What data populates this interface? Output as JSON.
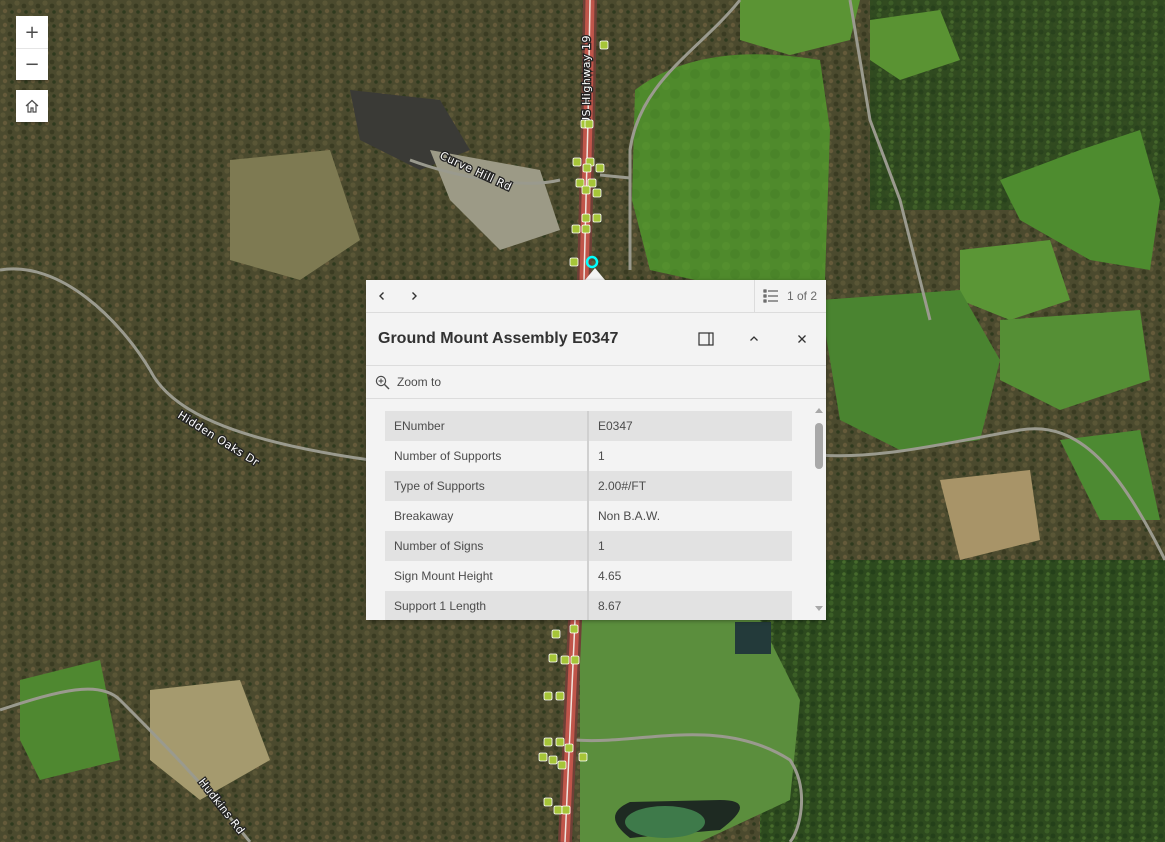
{
  "map": {
    "basemap": "satellite imagery",
    "colors": {
      "highway": "#c0554a",
      "sign_marker": "#a6c538",
      "selected_marker": "#00ffff"
    },
    "road_labels": [
      {
        "id": "us-highway-19",
        "text": "US Highway 19"
      },
      {
        "id": "curve-hill-rd",
        "text": "Curve Hill Rd"
      },
      {
        "id": "hidden-oaks-dr",
        "text": "Hidden Oaks Dr"
      },
      {
        "id": "hudkins-rd",
        "text": "Hudkins Rd"
      }
    ]
  },
  "controls": {
    "zoom_in_label": "+",
    "zoom_out_label": "−",
    "zoom_in_icon": "plus-icon",
    "zoom_out_icon": "minus-icon",
    "home_icon": "home-icon"
  },
  "popup": {
    "nav": {
      "prev_icon": "chevron-left-icon",
      "next_icon": "chevron-right-icon",
      "list_icon": "list-icon",
      "feature_count": "1 of 2"
    },
    "title": "Ground Mount Assembly E0347",
    "header_icons": [
      "dock-icon",
      "collapse-icon",
      "close-icon"
    ],
    "zoom_to_label": "Zoom to",
    "zoom_to_icon": "zoom-to-icon",
    "attributes": [
      {
        "field": "ENumber",
        "value": "E0347"
      },
      {
        "field": "Number of Supports",
        "value": "1"
      },
      {
        "field": "Type of Supports",
        "value": "2.00#/FT"
      },
      {
        "field": "Breakaway",
        "value": "Non B.A.W."
      },
      {
        "field": "Number of Signs",
        "value": "1"
      },
      {
        "field": "Sign Mount Height",
        "value": "4.65"
      },
      {
        "field": "Support 1 Length",
        "value": "8.67"
      }
    ]
  }
}
